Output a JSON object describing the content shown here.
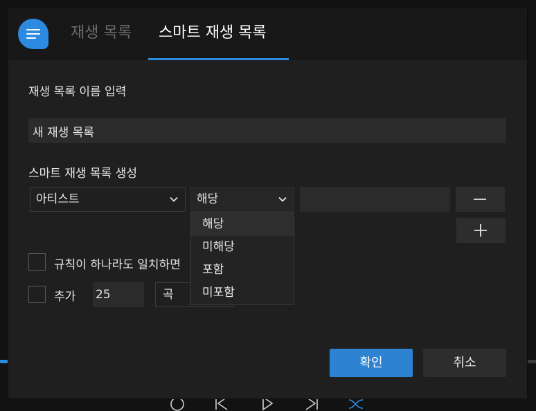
{
  "dialog": {
    "tabs": [
      {
        "label": "재생 목록",
        "active": false
      },
      {
        "label": "스마트 재생 목록",
        "active": true
      }
    ],
    "name_label": "재생 목록 이름 입력",
    "name_value": "새 재생 목록",
    "smart_label": "스마트 재생 목록 생성",
    "rule": {
      "field": "아티스트",
      "operator": "해당",
      "value": ""
    },
    "operator_options": [
      "해당",
      "미해당",
      "포함",
      "미포함"
    ],
    "highlighted_option": "해당",
    "match_any_label": "규칙이 하나라도 일치하면",
    "limit": {
      "label": "추가",
      "count": "25",
      "unit": "곡"
    },
    "ok_label": "확인",
    "cancel_label": "취소"
  },
  "icons": {
    "logo": "playlist-logo-icon",
    "remove": "minus-icon",
    "add": "plus-icon",
    "chevron": "chevron-down-icon",
    "player": [
      "repeat-icon",
      "previous-icon",
      "play-icon",
      "next-icon",
      "shuffle-icon"
    ]
  },
  "colors": {
    "accent": "#2c8ae0",
    "dialog_bg": "#1f1f1f",
    "header_bg": "#181818"
  }
}
